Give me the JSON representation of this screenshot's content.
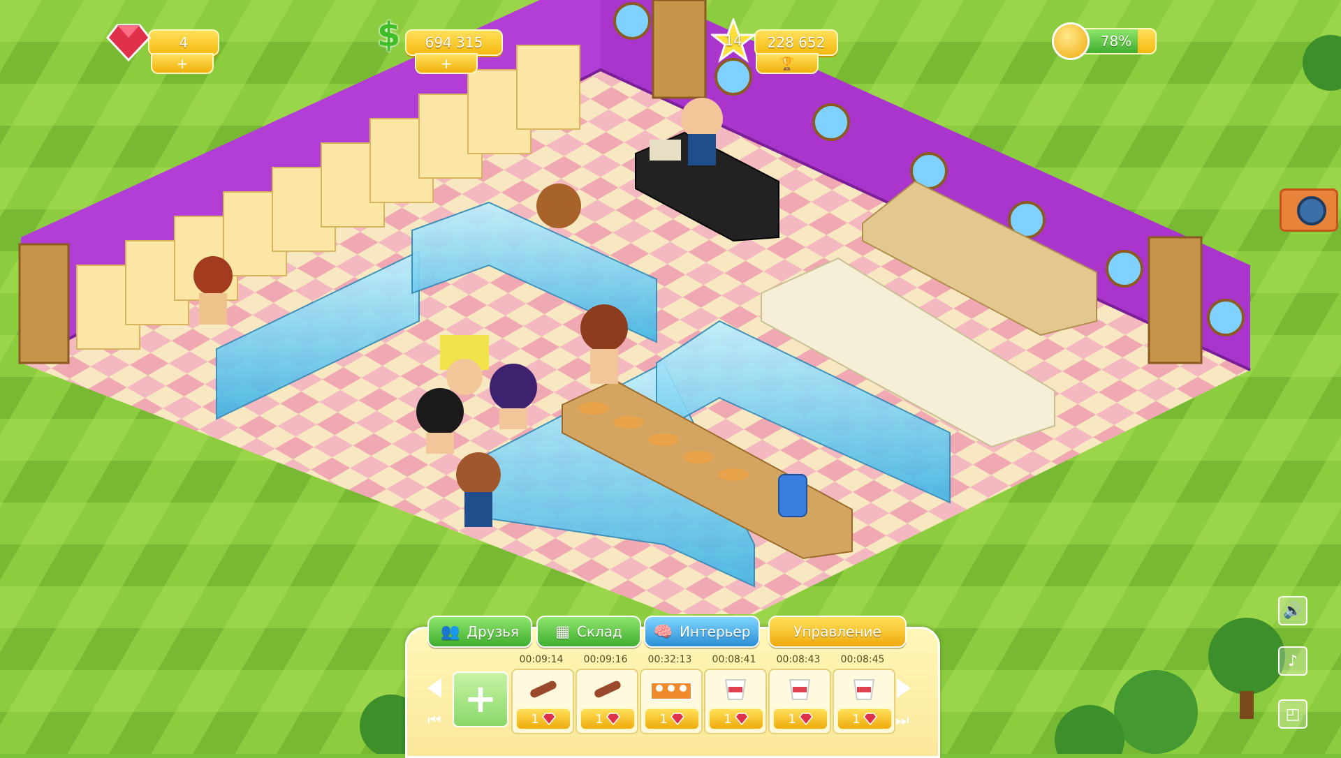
{
  "hud": {
    "gems": "4",
    "gems_plus": "+",
    "money": "694 315",
    "money_plus": "+",
    "money_icon": "$",
    "level": "14",
    "xp": "228 652",
    "trophy_icon": "trophy-icon",
    "happiness": "78%",
    "happiness_fill": 0.78
  },
  "tabs": [
    {
      "label": "Друзья",
      "icon": "friends-icon"
    },
    {
      "label": "Склад",
      "icon": "grid-icon"
    },
    {
      "label": "Интерьер",
      "icon": "brain-icon"
    },
    {
      "label": "Управление",
      "icon": ""
    }
  ],
  "queue": [
    {
      "timer": "00:09:14",
      "cost": "1",
      "item": "sausage"
    },
    {
      "timer": "00:09:16",
      "cost": "1",
      "item": "sausage"
    },
    {
      "timer": "00:32:13",
      "cost": "1",
      "item": "pastry-box"
    },
    {
      "timer": "00:08:41",
      "cost": "1",
      "item": "noodle-box"
    },
    {
      "timer": "00:08:43",
      "cost": "1",
      "item": "noodle-box"
    },
    {
      "timer": "00:08:45",
      "cost": "1",
      "item": "noodle-box"
    }
  ],
  "add_slot_symbol": "+",
  "colors": {
    "grass_light": "#9bd64a",
    "grass_dark": "#6fb52e",
    "wall": "#b23ed6",
    "floor_pink": "#f4b8c0",
    "floor_cream": "#f7e8c2",
    "accent_gold": "#f5b90f"
  }
}
